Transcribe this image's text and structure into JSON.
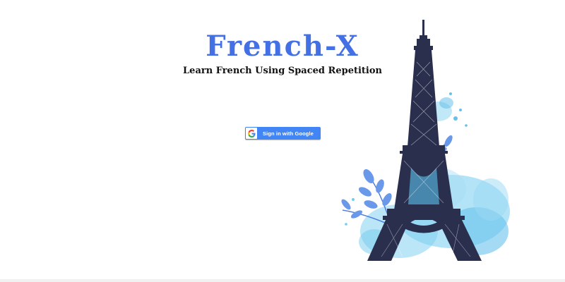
{
  "app": {
    "title": "French-X",
    "tagline": "Learn French Using Spaced Repetition"
  },
  "auth": {
    "google_button_label": "Sign in with Google",
    "google_icon": "google-g-icon"
  },
  "illustration": {
    "name": "eiffel-tower-watercolor",
    "colors": {
      "tower": "#2b2f4e",
      "splash": "#5bc3ec",
      "splash_light": "#9ad9f4",
      "leaves": "#5a8fe8"
    }
  },
  "colors": {
    "accent": "#4470e6",
    "google_blue": "#4285f4"
  }
}
